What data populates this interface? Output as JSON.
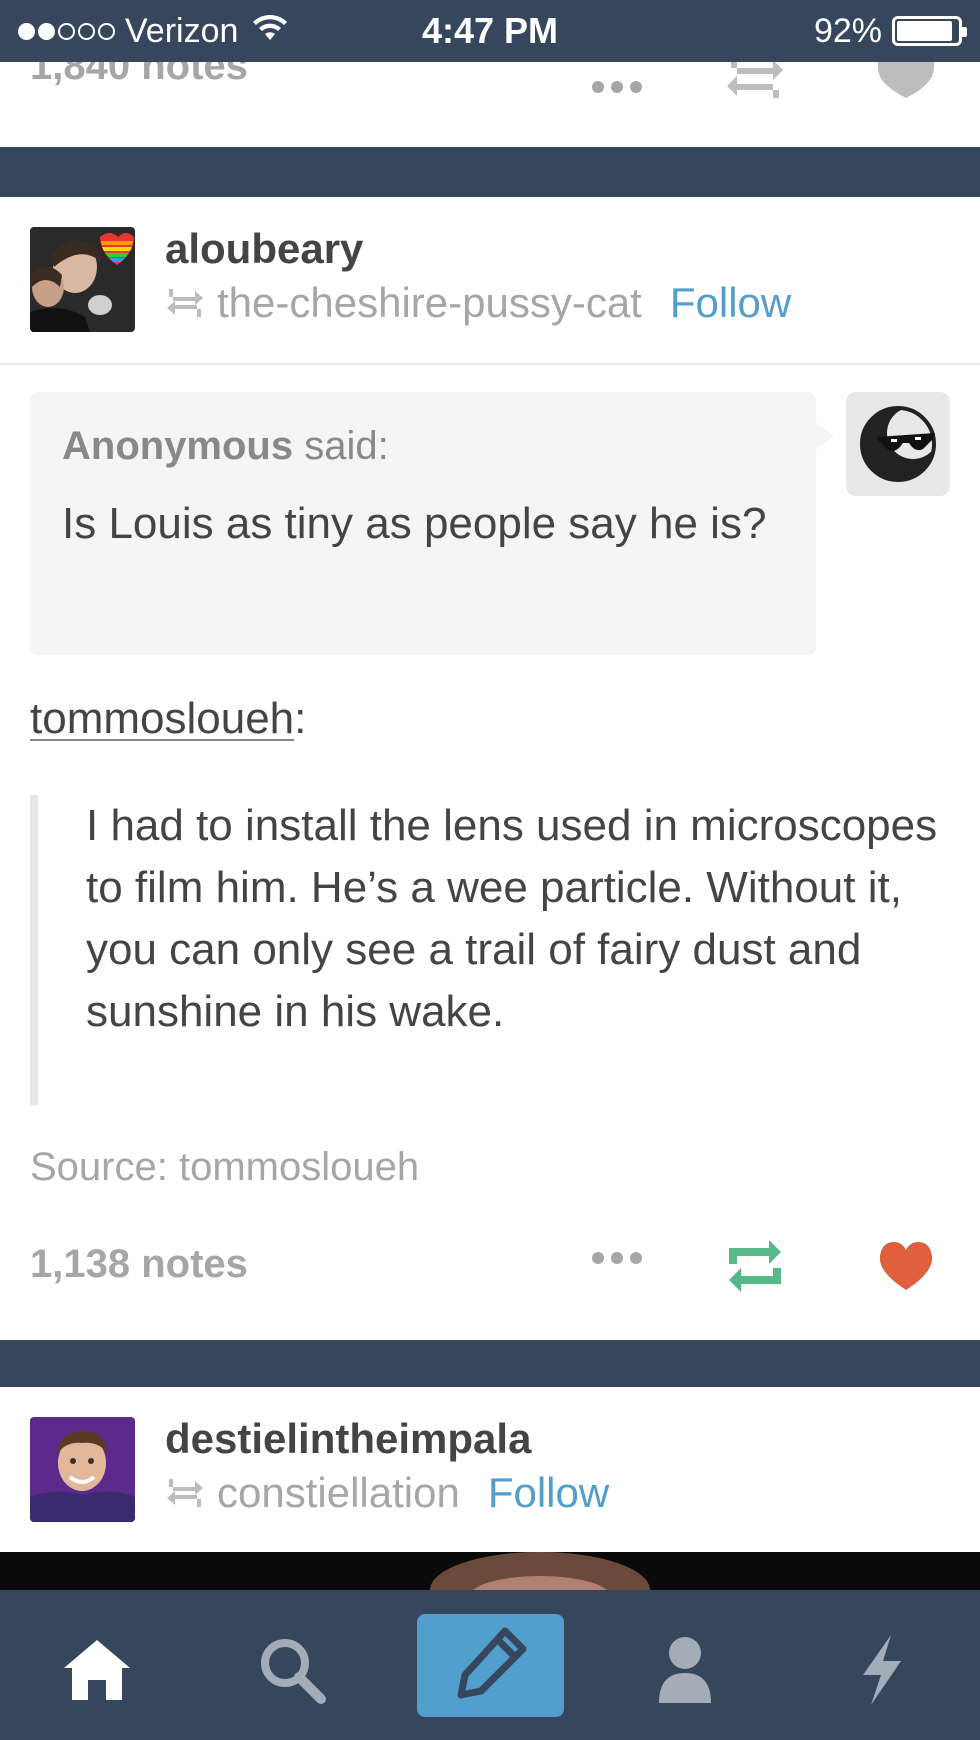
{
  "status_bar": {
    "carrier": "Verizon",
    "time": "4:47 PM",
    "battery_percent": "92%",
    "signal_strength": 2,
    "signal_max": 5,
    "battery_level": 0.92
  },
  "previous_post": {
    "notes": "1,840 notes",
    "more_icon": "more-dots-icon",
    "reblog_icon": "reblog-icon",
    "like_icon": "heart-icon"
  },
  "post": {
    "username": "aloubeary",
    "reblogged_from": "the-cheshire-pussy-cat",
    "follow_label": "Follow",
    "ask": {
      "asker": "Anonymous",
      "said": "said:",
      "question": "Is Louis as tiny as people say he is?"
    },
    "answerer": "tommosloueh",
    "answerer_suffix": ":",
    "answer": "I had to install the lens used in microscopes to film him. He’s a wee particle. Without it, you can only see a trail of fairy dust and sunshine in his wake.",
    "source": "Source: tommosloueh",
    "notes": "1,138 notes",
    "colors": {
      "reblog_active": "#56b98a",
      "like_active": "#e0603e",
      "link": "#529ecc"
    }
  },
  "next_post": {
    "username": "destielintheimpala",
    "reblogged_from": "constiellation",
    "follow_label": "Follow"
  },
  "bottom_nav": {
    "items": [
      "home-icon",
      "search-icon",
      "compose-icon",
      "account-icon",
      "activity-icon"
    ],
    "colors": {
      "bar": "#36465d",
      "compose": "#529ecc",
      "inactive": "#a4acb8"
    }
  }
}
